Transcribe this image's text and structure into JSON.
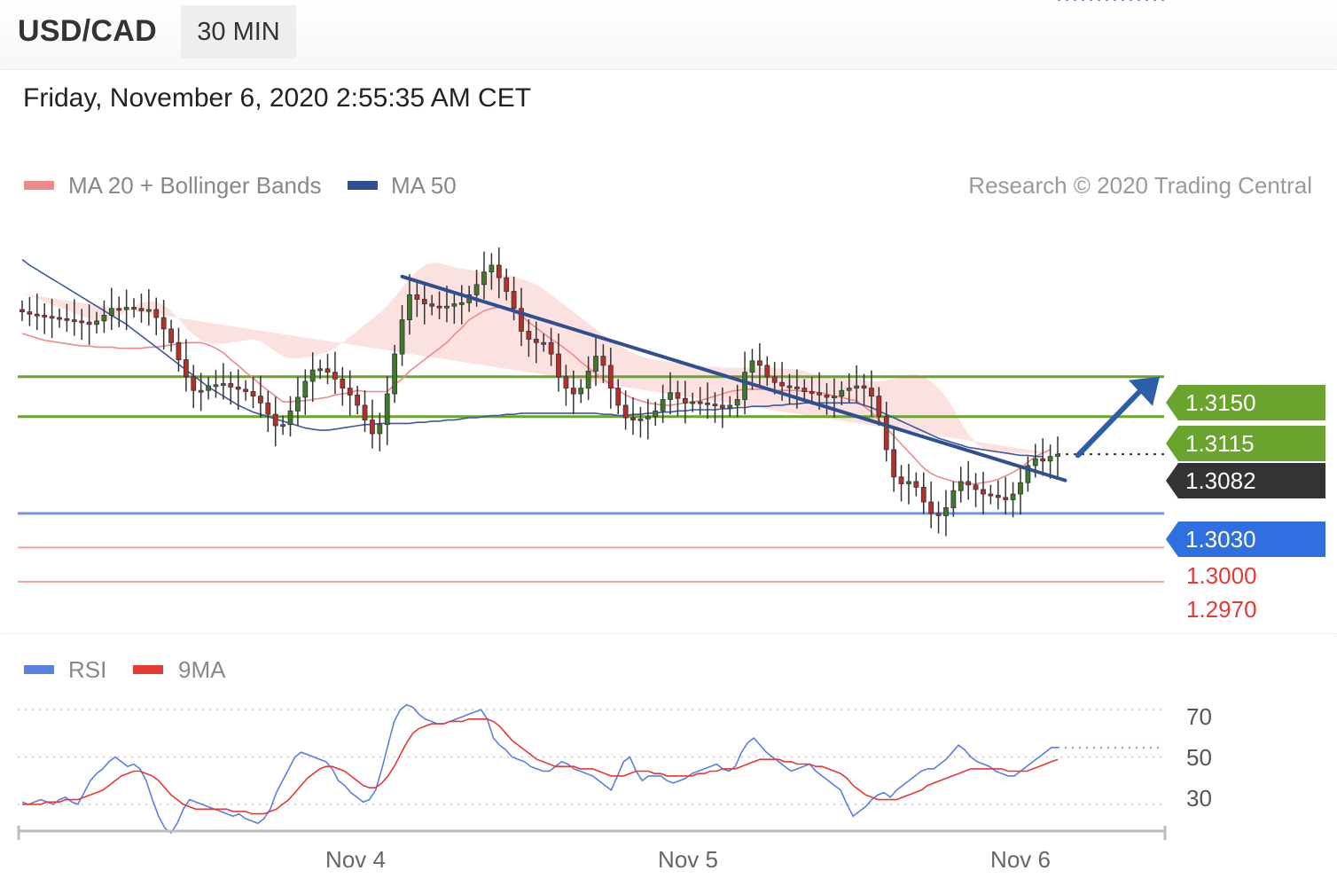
{
  "header": {
    "symbol": "USD/CAD",
    "timeframe": "30 MIN",
    "datetime": "Friday, November 6, 2020 2:55:35 AM CET"
  },
  "legend": {
    "ma20_bb": {
      "label": "MA 20 + Bollinger Bands",
      "color": "#ef8a8a"
    },
    "ma50": {
      "label": "MA 50",
      "color": "#2f4f8f"
    },
    "credit": "Research © 2020 Trading Central"
  },
  "rsi_legend": {
    "rsi": {
      "label": "RSI",
      "color": "#5b7fe0"
    },
    "ma9": {
      "label": "9MA",
      "color": "#e53935"
    }
  },
  "levels": [
    {
      "value": "1.3150",
      "kind": "resistance",
      "color": "#6aa42e"
    },
    {
      "value": "1.3115",
      "kind": "resistance",
      "color": "#6aa42e"
    },
    {
      "value": "1.3082",
      "kind": "last",
      "color": "#333333"
    },
    {
      "value": "1.3030",
      "kind": "pivot",
      "color": "#2f6fe0"
    },
    {
      "value": "1.3000",
      "kind": "support",
      "color": "#e53935"
    },
    {
      "value": "1.2970",
      "kind": "support",
      "color": "#e53935"
    }
  ],
  "x_labels": [
    "Nov 4",
    "Nov 5",
    "Nov 6"
  ],
  "rsi_ticks": [
    "70",
    "50",
    "30"
  ],
  "chart_data": [
    {
      "type": "candlestick",
      "title": "USD/CAD",
      "timeframe": "30 MIN",
      "ylim": [
        1.2945,
        1.3255
      ],
      "x_labels": [
        "Nov 4",
        "Nov 5",
        "Nov 6"
      ],
      "horizontal_levels": [
        1.315,
        1.3115,
        1.303,
        1.3,
        1.297
      ],
      "last_price": 1.3082,
      "close_series": [
        1.3207,
        1.3205,
        1.3204,
        1.3203,
        1.3202,
        1.3201,
        1.32,
        1.3199,
        1.3198,
        1.3196,
        1.3199,
        1.3204,
        1.321,
        1.3209,
        1.3211,
        1.321,
        1.3208,
        1.3209,
        1.3202,
        1.3192,
        1.318,
        1.3165,
        1.315,
        1.3138,
        1.3138,
        1.3142,
        1.3143,
        1.3144,
        1.3141,
        1.3139,
        1.3137,
        1.3133,
        1.3127,
        1.3117,
        1.3107,
        1.3108,
        1.312,
        1.3132,
        1.3146,
        1.3156,
        1.3157,
        1.3154,
        1.3148,
        1.314,
        1.3134,
        1.3125,
        1.3112,
        1.31,
        1.3108,
        1.3135,
        1.317,
        1.32,
        1.3222,
        1.3218,
        1.3214,
        1.3212,
        1.3211,
        1.3212,
        1.3214,
        1.3215,
        1.3222,
        1.3231,
        1.3242,
        1.3248,
        1.3237,
        1.3225,
        1.321,
        1.319,
        1.3183,
        1.318,
        1.318,
        1.317,
        1.315,
        1.314,
        1.3135,
        1.314,
        1.3155,
        1.3168,
        1.316,
        1.314,
        1.3125,
        1.3114,
        1.3112,
        1.3113,
        1.3115,
        1.312,
        1.313,
        1.3136,
        1.3131,
        1.3127,
        1.3128,
        1.3127,
        1.3126,
        1.3125,
        1.3123,
        1.3125,
        1.313,
        1.3154,
        1.3164,
        1.316,
        1.315,
        1.3145,
        1.3142,
        1.3141,
        1.314,
        1.3137,
        1.3136,
        1.3134,
        1.3132,
        1.3133,
        1.3138,
        1.314,
        1.3142,
        1.314,
        1.3133,
        1.3115,
        1.3086,
        1.3062,
        1.3056,
        1.3058,
        1.3053,
        1.304,
        1.303,
        1.3028,
        1.3035,
        1.305,
        1.3058,
        1.3055,
        1.3051,
        1.3047,
        1.3046,
        1.3044,
        1.3042,
        1.3047,
        1.3057,
        1.3072,
        1.3078,
        1.3076,
        1.308,
        1.3082
      ],
      "ma20": [
        1.3188,
        1.3186,
        1.3184,
        1.3182,
        1.3181,
        1.318,
        1.3179,
        1.3178,
        1.3177,
        1.3177,
        1.3176,
        1.3176,
        1.3176,
        1.3175,
        1.3175,
        1.3175,
        1.3175,
        1.3176,
        1.3176,
        1.3177,
        1.3178,
        1.3179,
        1.318,
        1.318,
        1.318,
        1.3178,
        1.3175,
        1.3171,
        1.3165,
        1.316,
        1.3154,
        1.3149,
        1.3143,
        1.3138,
        1.3133,
        1.3128,
        1.3128,
        1.3129,
        1.3129,
        1.313,
        1.3131,
        1.3132,
        1.3134,
        1.3135,
        1.3136,
        1.3138,
        1.3137,
        1.3137,
        1.3137,
        1.3137,
        1.3143,
        1.3148,
        1.3155,
        1.316,
        1.3165,
        1.317,
        1.3175,
        1.318,
        1.3187,
        1.3193,
        1.32,
        1.3204,
        1.3208,
        1.321,
        1.3211,
        1.3209,
        1.3207,
        1.3204,
        1.3198,
        1.3193,
        1.3188,
        1.3183,
        1.3179,
        1.3174,
        1.3169,
        1.3163,
        1.3158,
        1.3153,
        1.3148,
        1.3143,
        1.3138,
        1.3134,
        1.3131,
        1.3129,
        1.3127,
        1.3126,
        1.3125,
        1.3125,
        1.3126,
        1.3127,
        1.3128,
        1.3129,
        1.3131,
        1.3133,
        1.3135,
        1.3137,
        1.3138,
        1.3139,
        1.3139,
        1.3139,
        1.3139,
        1.3138,
        1.3138,
        1.3138,
        1.3138,
        1.3137,
        1.3137,
        1.3136,
        1.3135,
        1.3133,
        1.3132,
        1.313,
        1.3129,
        1.3124,
        1.3119,
        1.3112,
        1.3105,
        1.3098,
        1.3091,
        1.3084,
        1.3077,
        1.307,
        1.3065,
        1.3062,
        1.306,
        1.3058,
        1.3057,
        1.3056,
        1.3056,
        1.3057,
        1.3058,
        1.306,
        1.3063,
        1.3066,
        1.307,
        1.3075,
        1.308,
        1.3083,
        1.3086
      ],
      "bollinger_upper": [
        1.3223,
        1.3221,
        1.3219,
        1.3216,
        1.3213,
        1.3211,
        1.3209,
        1.3206,
        1.3203,
        1.3201,
        1.3199,
        1.3199,
        1.32,
        1.3203,
        1.3208,
        1.3212,
        1.3215,
        1.3216,
        1.3216,
        1.3213,
        1.3208,
        1.3201,
        1.3193,
        1.3187,
        1.3182,
        1.318,
        1.3179,
        1.3179,
        1.318,
        1.3181,
        1.3182,
        1.3183,
        1.3181,
        1.3177,
        1.3172,
        1.3168,
        1.3166,
        1.3166,
        1.3167,
        1.3168,
        1.317,
        1.3172,
        1.3175,
        1.318,
        1.3185,
        1.319,
        1.3196,
        1.3201,
        1.3206,
        1.3212,
        1.322,
        1.3228,
        1.3236,
        1.3243,
        1.3248,
        1.325,
        1.325,
        1.3248,
        1.3246,
        1.3245,
        1.3244,
        1.3243,
        1.3242,
        1.3241,
        1.324,
        1.3239,
        1.3238,
        1.3236,
        1.3234,
        1.3231,
        1.3227,
        1.3222,
        1.3217,
        1.3212,
        1.3207,
        1.3202,
        1.3197,
        1.3192,
        1.3187,
        1.3182,
        1.3178,
        1.3174,
        1.3171,
        1.3168,
        1.3166,
        1.3165,
        1.3164,
        1.3163,
        1.3162,
        1.3161,
        1.316,
        1.316,
        1.3159,
        1.3159,
        1.3158,
        1.3158,
        1.3158,
        1.3158,
        1.3158,
        1.3158,
        1.3158,
        1.3158,
        1.3157,
        1.3157,
        1.3156,
        1.3155,
        1.3153,
        1.3152,
        1.3151,
        1.315,
        1.3149,
        1.3148,
        1.3148,
        1.3147,
        1.3146,
        1.3146,
        1.3147,
        1.3148,
        1.315,
        1.3152,
        1.3152,
        1.315,
        1.3146,
        1.314,
        1.3132,
        1.3122,
        1.311,
        1.31,
        1.3092,
        1.3086,
        1.3084,
        1.3083,
        1.3083,
        1.3083,
        1.3083,
        1.3083,
        1.3083,
        1.3083,
        1.3083
      ],
      "bollinger_lower": [
        1.3163,
        1.316,
        1.3158,
        1.3155,
        1.3152,
        1.3149,
        1.3146,
        1.3143,
        1.314,
        1.3137,
        1.3134,
        1.3131,
        1.3128,
        1.3125,
        1.3121,
        1.3118,
        1.3115,
        1.3112,
        1.3109,
        1.3106,
        1.3103,
        1.31,
        1.3098,
        1.3097,
        1.3097,
        1.3098,
        1.3099,
        1.31,
        1.3101,
        1.3102,
        1.3103,
        1.3104,
        1.3104,
        1.3103,
        1.31,
        1.3097,
        1.3094,
        1.3092,
        1.3091,
        1.3091,
        1.3091,
        1.3091,
        1.3092,
        1.3093,
        1.3094,
        1.3096,
        1.3098,
        1.3099,
        1.31,
        1.3098,
        1.3096,
        1.3094,
        1.3093,
        1.3093,
        1.3094,
        1.3095,
        1.3097,
        1.3099,
        1.3101,
        1.3103,
        1.3106,
        1.311,
        1.3115,
        1.312,
        1.3124,
        1.3126,
        1.3125,
        1.312,
        1.3114,
        1.3108,
        1.3102,
        1.3096,
        1.3091,
        1.3087,
        1.3085,
        1.3084,
        1.3084,
        1.3085,
        1.3086,
        1.3088,
        1.3089,
        1.309,
        1.3091,
        1.3092,
        1.3093,
        1.3094,
        1.3095,
        1.3096,
        1.3097,
        1.3098,
        1.3099,
        1.31,
        1.3101,
        1.3102,
        1.3103,
        1.3104,
        1.3105,
        1.3106,
        1.3107,
        1.3108,
        1.3109,
        1.311,
        1.3111,
        1.3112,
        1.3113,
        1.3114,
        1.3115,
        1.3115,
        1.3114,
        1.3112,
        1.311,
        1.3106,
        1.31,
        1.3092,
        1.3082,
        1.307,
        1.3057,
        1.3045,
        1.3035,
        1.3028,
        1.3024,
        1.3022,
        1.3021,
        1.3021,
        1.3022,
        1.3023,
        1.3024,
        1.3026,
        1.3028,
        1.303,
        1.3032,
        1.3034,
        1.3036,
        1.3038,
        1.304,
        1.3042,
        1.3044,
        1.3046,
        1.3048
      ],
      "ma50": [
        1.3253,
        1.3248,
        1.3244,
        1.324,
        1.3236,
        1.3232,
        1.3228,
        1.3224,
        1.322,
        1.3216,
        1.3212,
        1.3208,
        1.3204,
        1.32,
        1.3196,
        1.3191,
        1.3186,
        1.3181,
        1.3176,
        1.3171,
        1.3166,
        1.3161,
        1.3156,
        1.3151,
        1.3146,
        1.3141,
        1.3137,
        1.3133,
        1.3129,
        1.3125,
        1.3122,
        1.3119,
        1.3117,
        1.3115,
        1.3113,
        1.3111,
        1.3109,
        1.3107,
        1.3105,
        1.3104,
        1.3103,
        1.3103,
        1.3104,
        1.3105,
        1.3106,
        1.3107,
        1.3108,
        1.3108,
        1.3109,
        1.3109,
        1.3109,
        1.3109,
        1.3109,
        1.311,
        1.311,
        1.3111,
        1.3111,
        1.3112,
        1.3112,
        1.3113,
        1.3114,
        1.3114,
        1.3115,
        1.3116,
        1.3116,
        1.3117,
        1.3117,
        1.3118,
        1.3118,
        1.3118,
        1.3118,
        1.3118,
        1.3118,
        1.3118,
        1.3118,
        1.3118,
        1.3118,
        1.3118,
        1.3117,
        1.3117,
        1.3116,
        1.3116,
        1.3117,
        1.3117,
        1.3118,
        1.3118,
        1.3119,
        1.3119,
        1.312,
        1.312,
        1.3121,
        1.3121,
        1.3121,
        1.3121,
        1.3122,
        1.3122,
        1.3123,
        1.3123,
        1.3124,
        1.3124,
        1.3124,
        1.3125,
        1.3125,
        1.3126,
        1.3126,
        1.3127,
        1.3127,
        1.3127,
        1.3127,
        1.3127,
        1.3127,
        1.3127,
        1.3127,
        1.3125,
        1.3123,
        1.312,
        1.3117,
        1.3114,
        1.3111,
        1.3108,
        1.3105,
        1.3102,
        1.3099,
        1.3096,
        1.3094,
        1.3092,
        1.309,
        1.3088,
        1.3087,
        1.3086,
        1.3085,
        1.3084,
        1.3083,
        1.3082,
        1.3081,
        1.3081,
        1.308,
        1.308
      ],
      "trendline": [
        [
          51,
          1.3238
        ],
        [
          140,
          1.3059
        ]
      ],
      "forecast_arrow": [
        [
          141,
          1.3081
        ],
        [
          156,
          1.315
        ]
      ]
    },
    {
      "type": "line",
      "title": "RSI",
      "ylim": [
        15,
        85
      ],
      "reference_lines": [
        70,
        50,
        30
      ],
      "series": [
        {
          "name": "RSI",
          "values": [
            31,
            30,
            31,
            32,
            31,
            30,
            32,
            33,
            31,
            30,
            35,
            40,
            43,
            45,
            48,
            50,
            48,
            46,
            47,
            45,
            40,
            32,
            25,
            20,
            18,
            22,
            28,
            32,
            31,
            30,
            29,
            28,
            27,
            26,
            25,
            26,
            24,
            23,
            22,
            24,
            28,
            35,
            40,
            45,
            50,
            52,
            51,
            50,
            49,
            48,
            45,
            40,
            38,
            35,
            33,
            31,
            32,
            36,
            45,
            55,
            65,
            70,
            72,
            71,
            68,
            66,
            65,
            64,
            64,
            65,
            66,
            67,
            68,
            69,
            70,
            66,
            58,
            55,
            53,
            50,
            49,
            48,
            46,
            45,
            44,
            44,
            46,
            48,
            47,
            45,
            44,
            43,
            42,
            40,
            38,
            36,
            42,
            48,
            50,
            44,
            40,
            42,
            42,
            42,
            40,
            39,
            40,
            41,
            43,
            44,
            45,
            46,
            47,
            45,
            44,
            46,
            52,
            56,
            58,
            55,
            52,
            50,
            48,
            46,
            44,
            45,
            46,
            47,
            44,
            42,
            40,
            38,
            36,
            30,
            25,
            27,
            29,
            32,
            34,
            35,
            33,
            36,
            38,
            40,
            42,
            44,
            45,
            45,
            47,
            49,
            52,
            55,
            53,
            50,
            48,
            47,
            46,
            44,
            43,
            42,
            42,
            44,
            46,
            48,
            50,
            52,
            54,
            54
          ],
          "color": "#5b7fe0"
        },
        {
          "name": "9MA",
          "values": [
            30,
            30,
            30,
            30,
            31,
            31,
            31,
            32,
            32,
            32,
            33,
            34,
            35,
            36,
            38,
            40,
            42,
            43,
            44,
            44,
            43,
            42,
            40,
            37,
            34,
            32,
            30,
            29,
            28,
            28,
            28,
            28,
            28,
            28,
            27,
            27,
            27,
            26,
            26,
            26,
            27,
            28,
            30,
            32,
            35,
            38,
            41,
            43,
            45,
            46,
            46,
            45,
            44,
            42,
            40,
            38,
            37,
            37,
            39,
            42,
            46,
            51,
            56,
            60,
            62,
            63,
            64,
            64,
            64,
            65,
            65,
            65,
            66,
            66,
            66,
            66,
            65,
            63,
            60,
            57,
            55,
            53,
            51,
            49,
            48,
            47,
            46,
            46,
            46,
            46,
            45,
            45,
            45,
            44,
            43,
            42,
            42,
            42,
            43,
            44,
            44,
            44,
            43,
            43,
            42,
            42,
            42,
            42,
            42,
            43,
            43,
            44,
            44,
            45,
            45,
            45,
            46,
            47,
            48,
            49,
            49,
            49,
            49,
            48,
            48,
            47,
            47,
            47,
            46,
            46,
            45,
            44,
            43,
            41,
            38,
            36,
            34,
            33,
            32,
            32,
            32,
            32,
            33,
            34,
            35,
            36,
            38,
            39,
            40,
            41,
            42,
            43,
            44,
            45,
            45,
            45,
            45,
            45,
            45,
            44,
            44,
            44,
            44,
            45,
            46,
            47,
            48,
            49
          ],
          "color": "#e53935"
        }
      ]
    }
  ]
}
